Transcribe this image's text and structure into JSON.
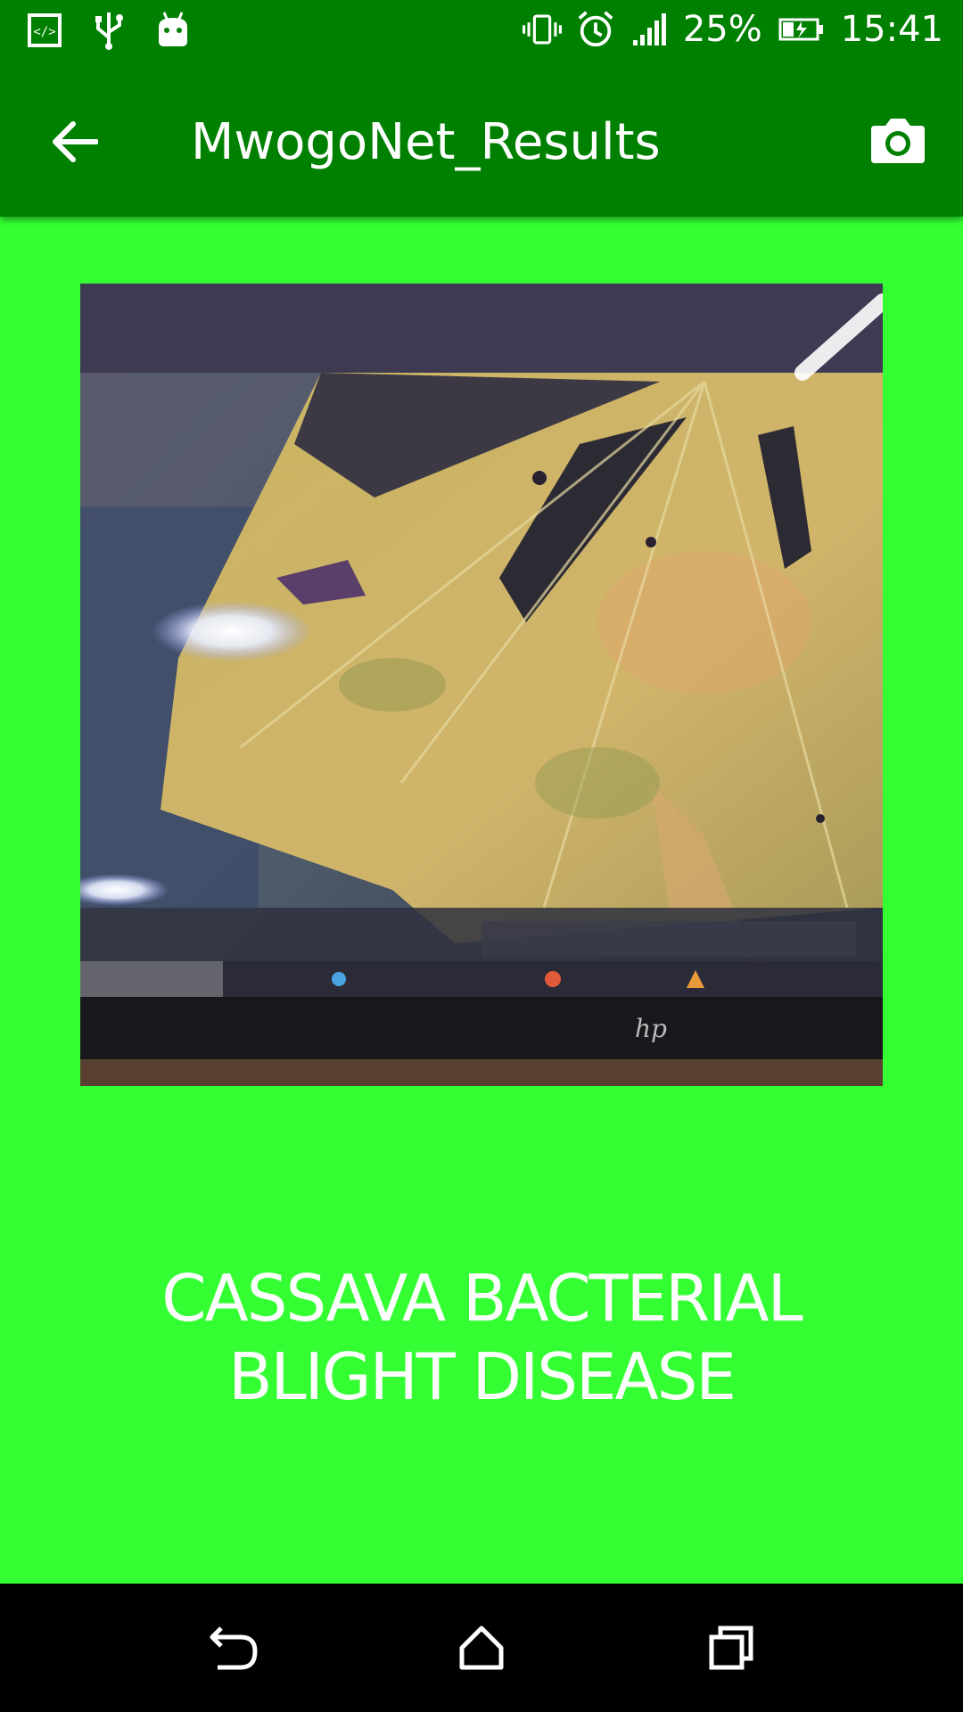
{
  "status_bar": {
    "battery_percent": "25%",
    "time": "15:41",
    "icons": [
      "code-icon",
      "usb-icon",
      "android-debug-icon",
      "vibrate-icon",
      "alarm-icon",
      "signal-icon",
      "battery-charging-icon"
    ]
  },
  "app_bar": {
    "title": "MwogoNet_Results",
    "back_icon": "arrow-back-icon",
    "camera_icon": "camera-icon"
  },
  "result": {
    "line1": "CASSAVA BACTERIAL",
    "line2": "BLIGHT DISEASE"
  },
  "nav_bar": {
    "icons": [
      "back-icon",
      "home-icon",
      "recents-icon"
    ]
  },
  "colors": {
    "app_bar": "#008000",
    "background": "#33ff33",
    "nav_bar": "#000000",
    "text": "#ffffff"
  }
}
